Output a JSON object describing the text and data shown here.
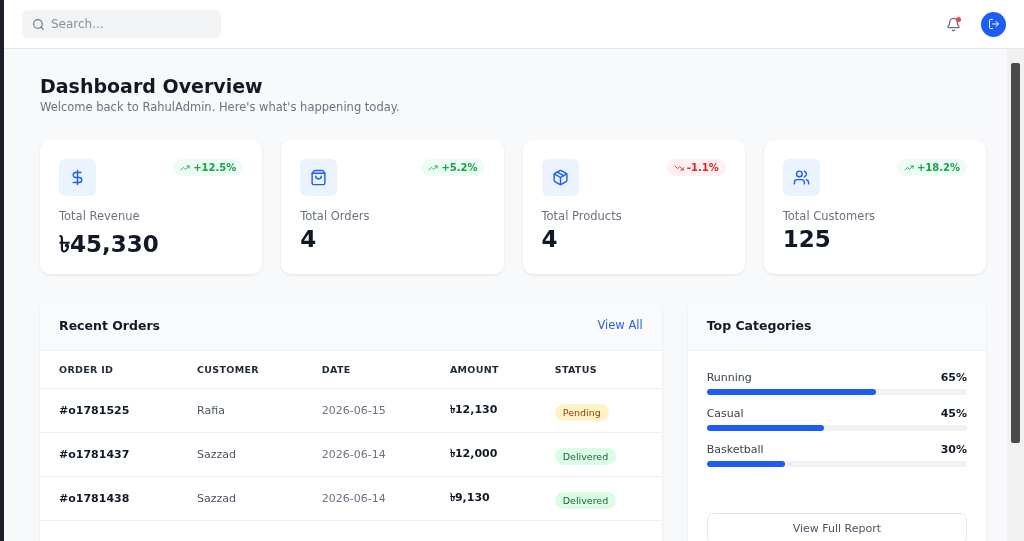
{
  "search": {
    "placeholder": "Search..."
  },
  "header": {
    "notification_dot": true
  },
  "page": {
    "title": "Dashboard Overview",
    "subtitle": "Welcome back to RahulAdmin. Here's what's happening today."
  },
  "stats": [
    {
      "kind": "revenue",
      "label": "Total Revenue",
      "value": "৳45,330",
      "change": "+12.5%",
      "rising": true
    },
    {
      "kind": "orders",
      "label": "Total Orders",
      "value": "4",
      "change": "+5.2%",
      "rising": true
    },
    {
      "kind": "products",
      "label": "Total Products",
      "value": "4",
      "change": "-1.1%",
      "rising": false
    },
    {
      "kind": "customers",
      "label": "Total Customers",
      "value": "125",
      "change": "+18.2%",
      "rising": true
    }
  ],
  "recent_orders": {
    "title": "Recent Orders",
    "link": "View All",
    "columns": [
      "ORDER ID",
      "CUSTOMER",
      "DATE",
      "AMOUNT",
      "STATUS"
    ],
    "rows": [
      {
        "id": "#o1781525",
        "customer": "Rafia",
        "date": "2026-06-15",
        "amount": "৳12,130",
        "status": "Pending",
        "kind": "pending"
      },
      {
        "id": "#o1781437",
        "customer": "Sazzad",
        "date": "2026-06-14",
        "amount": "৳12,000",
        "status": "Delivered",
        "kind": "delivered"
      },
      {
        "id": "#o1781438",
        "customer": "Sazzad",
        "date": "2026-06-14",
        "amount": "৳9,130",
        "status": "Delivered",
        "kind": "delivered"
      }
    ]
  },
  "top_categories": {
    "title": "Top Categories",
    "items": [
      {
        "name": "Running",
        "reading": "65%",
        "level": 0.65
      },
      {
        "name": "Casual",
        "reading": "45%",
        "level": 0.45
      },
      {
        "name": "Basketball",
        "reading": "30%",
        "level": 0.3
      }
    ],
    "button": "View Full Report"
  }
}
